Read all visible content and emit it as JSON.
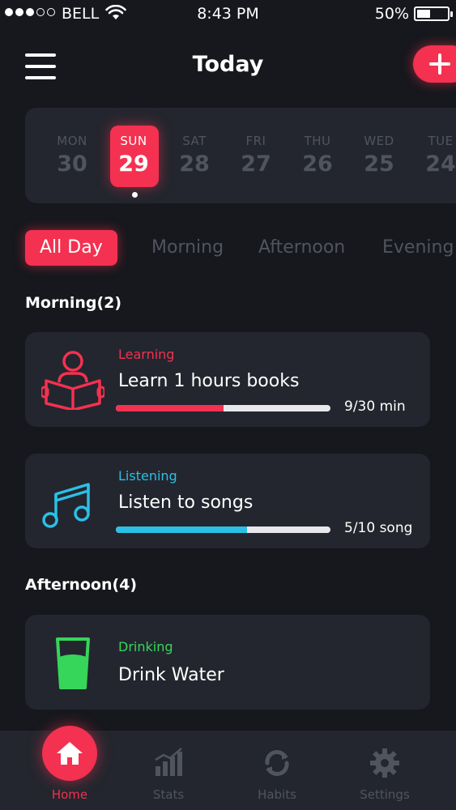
{
  "status_bar": {
    "carrier": "BELL",
    "time": "8:43 PM",
    "battery_percent": "50%",
    "battery_level": 0.5,
    "signal_dots_filled": 3,
    "signal_dots_total": 5
  },
  "header": {
    "title": "Today",
    "menu_icon": "hamburger-menu-icon",
    "add_icon": "plus-icon"
  },
  "date_strip": {
    "days": [
      {
        "name": "MON",
        "num": "30"
      },
      {
        "name": "SUN",
        "num": "29",
        "selected": true
      },
      {
        "name": "SAT",
        "num": "28"
      },
      {
        "name": "FRI",
        "num": "27"
      },
      {
        "name": "THU",
        "num": "26"
      },
      {
        "name": "WED",
        "num": "25"
      },
      {
        "name": "TUE",
        "num": "24"
      }
    ]
  },
  "tabs": [
    {
      "label": "All Day",
      "active": true
    },
    {
      "label": "Morning"
    },
    {
      "label": "Afternoon"
    },
    {
      "label": "Evening"
    }
  ],
  "sections": {
    "morning": "Morning(2)",
    "afternoon": "Afternoon(4)"
  },
  "habits": [
    {
      "category": "Learning",
      "title": "Learn 1 hours books",
      "progress_text": "9/30 min",
      "progress": 0.5,
      "color": "#f43150",
      "icon": "reading-person-icon"
    },
    {
      "category": "Listening",
      "title": "Listen to songs",
      "progress_text": "5/10 song",
      "progress": 0.61,
      "color": "#2bbfe6",
      "icon": "music-note-icon"
    },
    {
      "category": "Drinking",
      "title": "Drink Water",
      "color": "#36d65a",
      "icon": "water-glass-icon"
    }
  ],
  "nav": [
    {
      "label": "Home",
      "icon": "home-icon",
      "active": true
    },
    {
      "label": "Stats",
      "icon": "stats-chart-icon"
    },
    {
      "label": "Habits",
      "icon": "habits-cycle-icon"
    },
    {
      "label": "Settings",
      "icon": "gear-icon"
    }
  ],
  "colors": {
    "accent": "#f43150",
    "background": "#16181d",
    "card": "#23262e",
    "muted": "#50545f"
  }
}
